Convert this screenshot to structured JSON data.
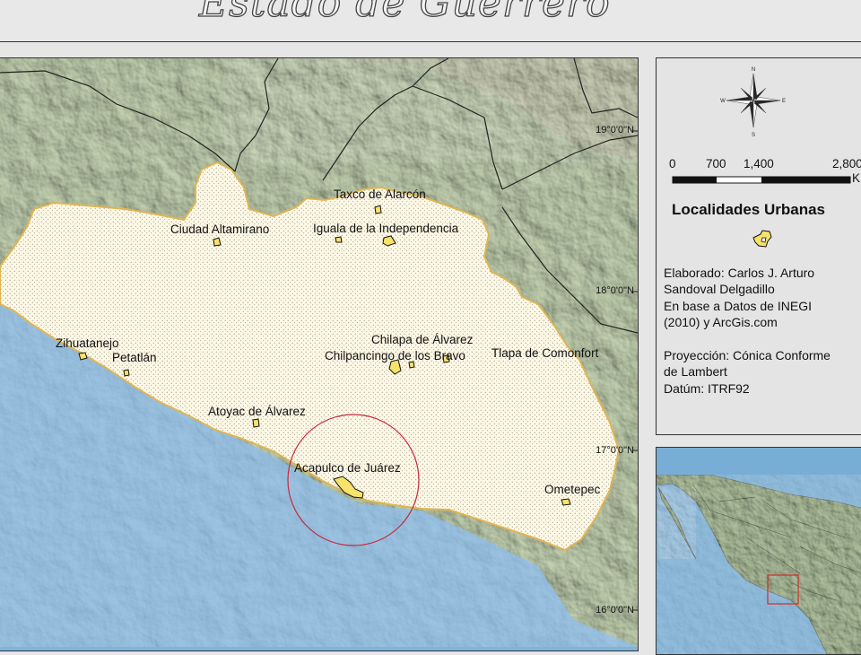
{
  "title": "Estado de Guerrero",
  "latitude_labels": [
    {
      "text": "19°0'0\"N"
    },
    {
      "text": "18°0'0\"N"
    },
    {
      "text": "17°0'0\"N"
    },
    {
      "text": "16°0'0\"N"
    }
  ],
  "localities": [
    {
      "name": "Taxco de Alarcón"
    },
    {
      "name": "Ciudad Altamirano"
    },
    {
      "name": "Iguala de la Independencia"
    },
    {
      "name": "Zihuatanejo"
    },
    {
      "name": "Petatlán"
    },
    {
      "name": "Chilapa de Álvarez"
    },
    {
      "name": "Chilpancingo de los Bravo"
    },
    {
      "name": "Tlapa de Comonfort"
    },
    {
      "name": "Atoyac de Álvarez"
    },
    {
      "name": "Acapulco de Juárez"
    },
    {
      "name": "Ometepec"
    }
  ],
  "scale_bar": {
    "ticks": [
      "0",
      "700",
      "1,400",
      "2,800"
    ],
    "unit": "K"
  },
  "legend": {
    "title": "Localidades Urbanas",
    "credits": [
      "Elaborado: Carlos J. Arturo",
      "Sandoval Delgadillo",
      "En base a Datos de INEGI",
      "(2010) y ArcGis.com",
      "",
      "Proyección: Cónica Conforme",
      "de Lambert",
      "Datúm: ITRF92"
    ]
  },
  "compass": {
    "n": "N",
    "s": "S",
    "e": "E",
    "w": "W"
  },
  "colors": {
    "ocean": "#7fb4dc",
    "state_fill": "#fdf8e6",
    "state_border": "#e0b552",
    "locality_fill": "#f7e26a",
    "highlight_circle": "#c8283c",
    "inset_box": "#d42a2a"
  }
}
